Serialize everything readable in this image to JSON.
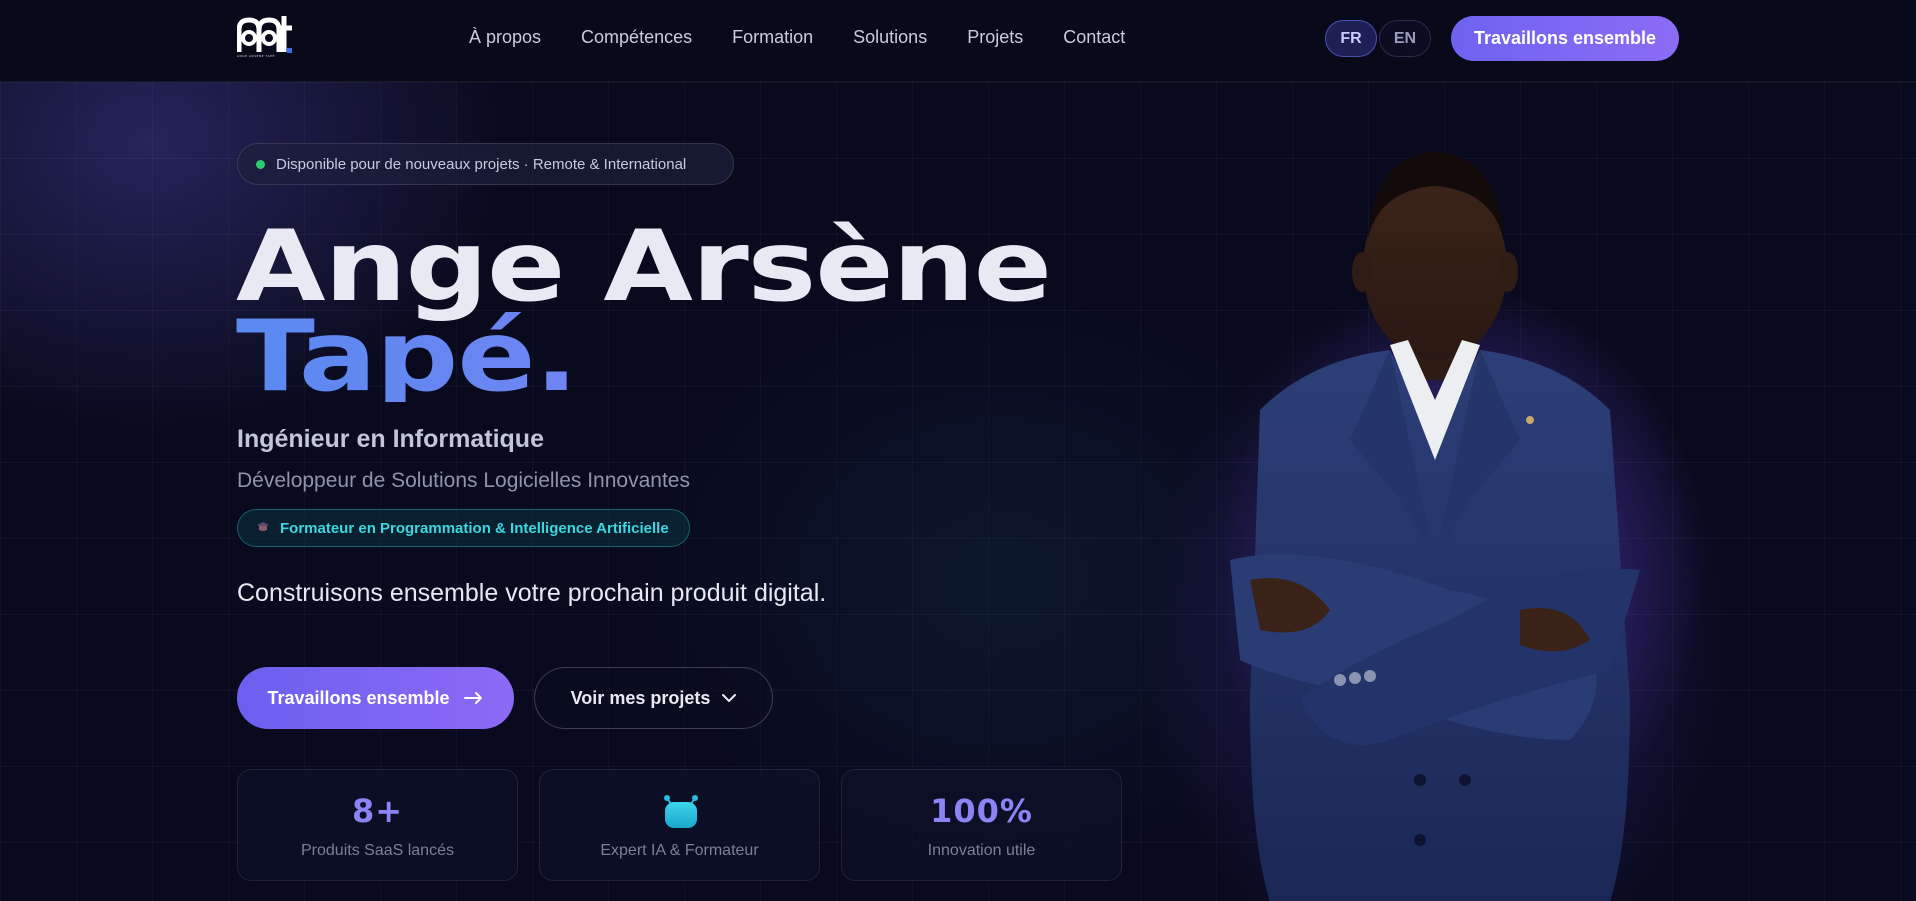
{
  "header": {
    "logo_text": "aat",
    "logo_subtext": "ANGE ARSÈNE TAPÉ",
    "nav": [
      {
        "label": "À propos"
      },
      {
        "label": "Compétences"
      },
      {
        "label": "Formation"
      },
      {
        "label": "Solutions"
      },
      {
        "label": "Projets"
      },
      {
        "label": "Contact"
      }
    ],
    "languages": [
      {
        "code": "FR",
        "active": true
      },
      {
        "code": "EN",
        "active": false
      }
    ],
    "cta_label": "Travaillons ensemble"
  },
  "hero": {
    "availability_badge": "Disponible pour de nouveaux projets · Remote & International",
    "name_line1": "Ange Arsène",
    "name_line2": "Tapé.",
    "role": "Ingénieur en Informatique",
    "subrole": "Développeur de Solutions Logicielles Innovantes",
    "trainer_tag": "Formateur en Programmation & Intelligence Artificielle",
    "tagline": "Construisons ensemble votre prochain produit digital.",
    "primary_button": "Travaillons ensemble",
    "secondary_button": "Voir mes projets",
    "stats": [
      {
        "value": "8+",
        "label": "Produits SaaS lancés"
      },
      {
        "value": "",
        "icon": "robot-icon",
        "label": "Expert IA & Formateur"
      },
      {
        "value": "100%",
        "label": "Innovation utile"
      }
    ]
  },
  "colors": {
    "background": "#07081a",
    "accent": "#7c6af5",
    "accent_blue": "#5a8af0",
    "status_green": "#2ecc71",
    "cyan": "#3fd6e0"
  },
  "icons": {
    "status_dot": "status-dot-icon",
    "arrow": "arrow-right-icon",
    "chevron": "chevron-down-icon",
    "trainer": "graduation-icon"
  }
}
